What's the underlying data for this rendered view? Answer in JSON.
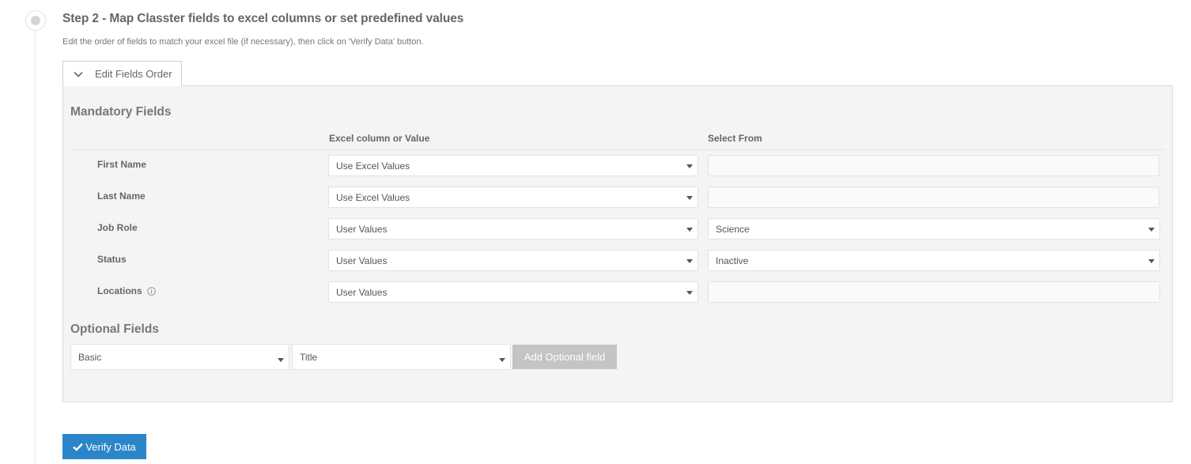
{
  "step": {
    "title": "Step 2 - Map Classter fields to excel columns or set predefined values",
    "description": "Edit the order of fields to match your excel file (if necessary), then click on 'Verify Data' button.",
    "edit_order_label": "Edit Fields Order"
  },
  "mandatory": {
    "title": "Mandatory Fields",
    "col_value_header": "Excel column or Value",
    "col_select_header": "Select From",
    "rows": [
      {
        "label": "First Name",
        "value": "Use Excel Values",
        "select_from": ""
      },
      {
        "label": "Last Name",
        "value": "Use Excel Values",
        "select_from": ""
      },
      {
        "label": "Job Role",
        "value": "User Values",
        "select_from": "Science"
      },
      {
        "label": "Status",
        "value": "User Values",
        "select_from": "Inactive"
      },
      {
        "label": "Locations",
        "value": "User Values",
        "select_from": ""
      }
    ]
  },
  "optional": {
    "title": "Optional Fields",
    "category": "Basic",
    "field": "Title",
    "add_label": "Add Optional field"
  },
  "verify_label": "Verify Data",
  "icons": {
    "chevron": "chevron-down-icon",
    "info": "info-icon",
    "check": "check-icon",
    "step": "step-indicator-icon"
  },
  "colors": {
    "primary": "#2a86c9",
    "disabled_button": "#c4c4c4",
    "panel_bg": "#f4f4f4"
  }
}
